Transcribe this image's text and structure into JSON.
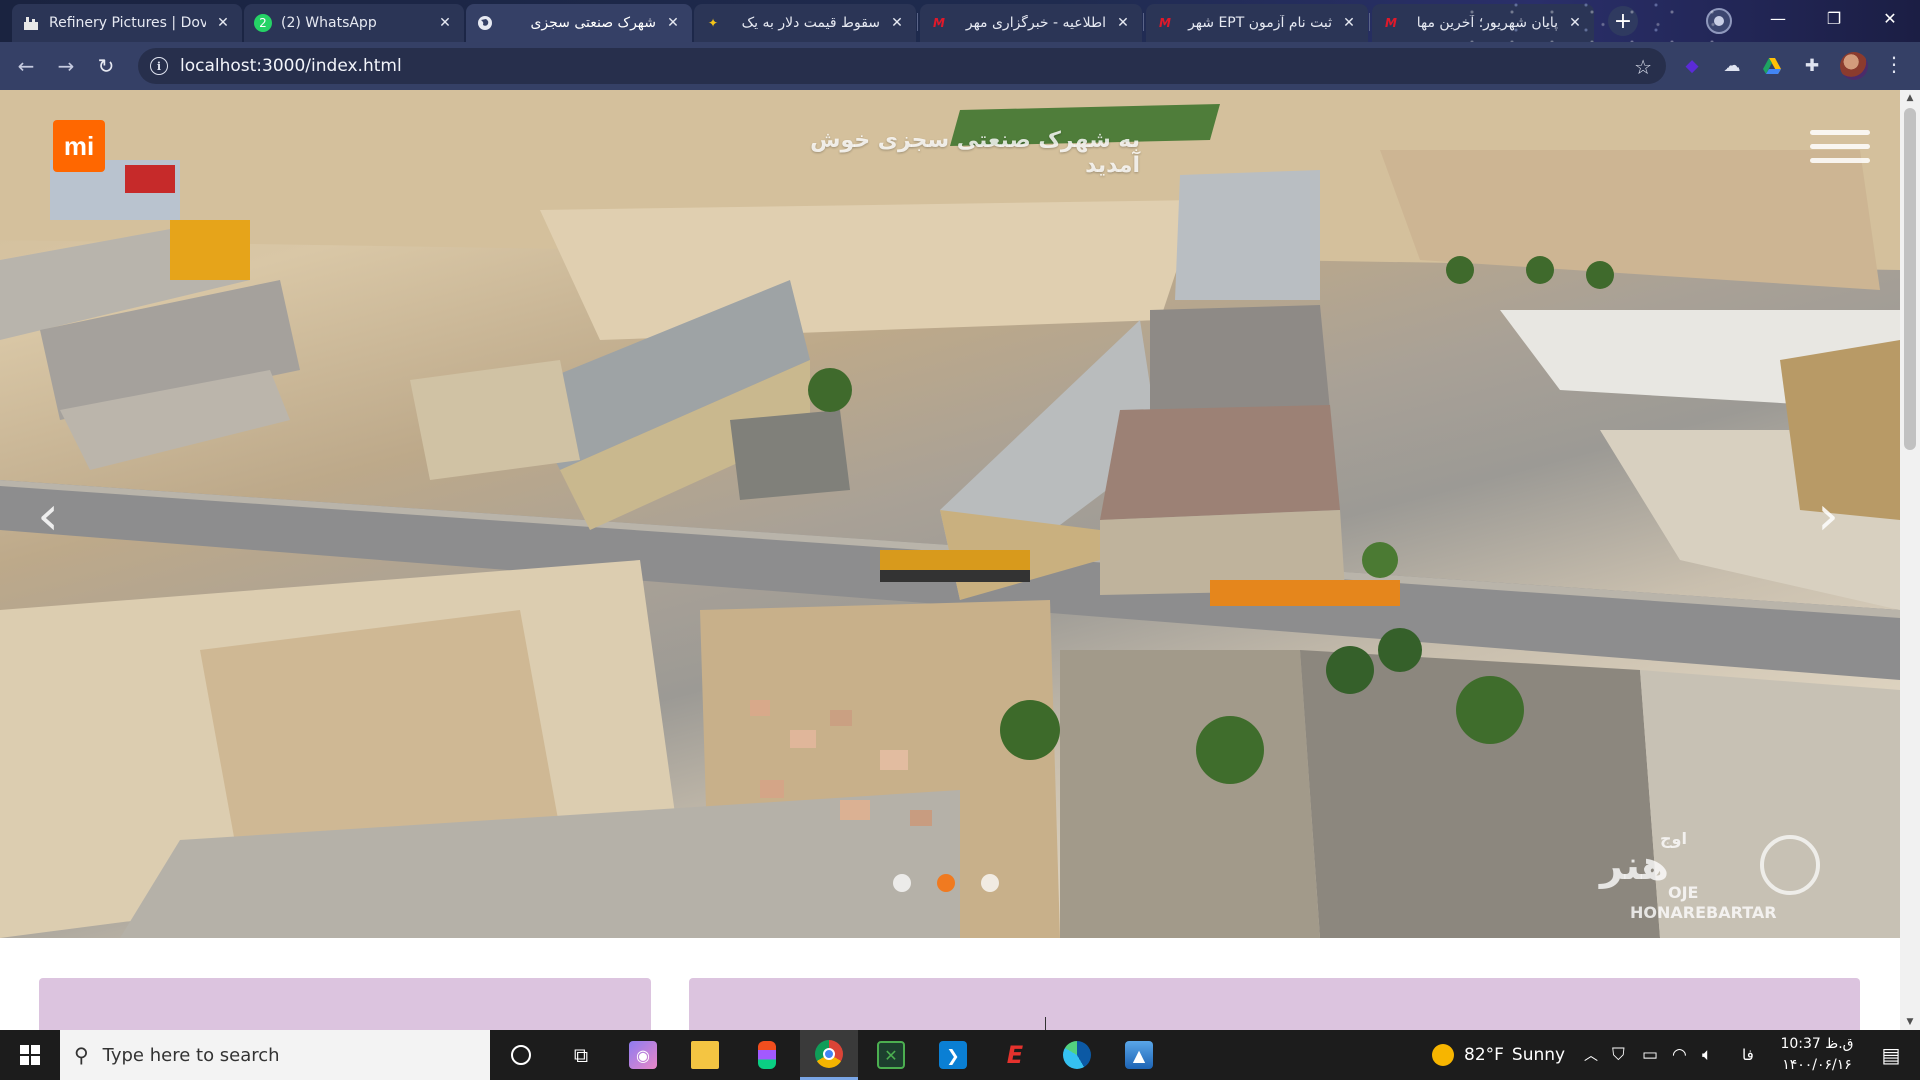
{
  "browser": {
    "tabs": [
      {
        "title": "Refinery Pictures | Dov",
        "favicon": "refinery-icon",
        "rtl": false
      },
      {
        "title": "(2) WhatsApp",
        "favicon": "whatsapp-icon",
        "rtl": false
      },
      {
        "title": "شهرک صنعتی سجزی",
        "favicon": "globe-icon",
        "rtl": true,
        "active": true
      },
      {
        "title": "سقوط قیمت دلار به یک",
        "favicon": "news-star-icon",
        "rtl": true
      },
      {
        "title": "اطلاعیه - خبرگزاری مهر",
        "favicon": "mehr-icon",
        "rtl": true
      },
      {
        "title": "ثبت نام آزمون EPT شهر",
        "favicon": "mehr-icon",
        "rtl": true
      },
      {
        "title": "پایان شهریور؛ آخرین مها",
        "favicon": "mehr-icon",
        "rtl": true
      }
    ],
    "url": "localhost:3000/index.html"
  },
  "page": {
    "logo_text": "mi",
    "hero_title": "به شهرک صنعتی سجزی خوش آمدید",
    "slide_prev": "‹",
    "slide_next": "›",
    "active_slide": 2,
    "slide_count": 3,
    "watermark": {
      "fa_main": "هنر",
      "fa_sub": "اوج",
      "en_line1": "OJE",
      "en_line2": "HONAREBARTAR"
    }
  },
  "taskbar": {
    "search_placeholder": "Type here to search",
    "weather_temp": "82°F",
    "weather_desc": "Sunny",
    "language": "فا",
    "time": "10:37 ق.ظ",
    "date": "۱۴۰۰/۰۶/۱۶"
  },
  "colors": {
    "accent_orange": "#f07a20",
    "mi_orange": "#ff6700",
    "card_lavender": "#dcc4df",
    "browser_frame": "#354066"
  }
}
